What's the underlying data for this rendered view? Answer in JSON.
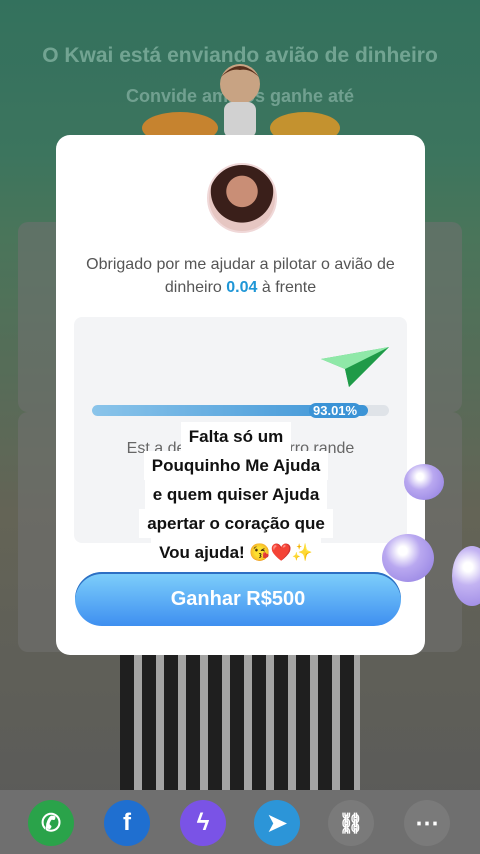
{
  "background": {
    "title": "O Kwai está enviando avião de dinheiro",
    "subtitle": "Convide amigos  ganhe até"
  },
  "modal": {
    "message_prefix": "Obrigado por me ajudar a pilotar o avião de dinheiro",
    "message_amount": "0.04",
    "message_suffix": "à frente",
    "progress_percent_label": "93.01%",
    "progress_value": 0.9301,
    "description": "Est  a de cheg  dirigir carro  rande",
    "cta_label": "Ganhar R$500"
  },
  "caption": {
    "lines": [
      "Falta só um",
      "Pouquinho Me Ajuda",
      "e quem quiser Ajuda",
      "apertar o coração que",
      "Vou ajuda! 😘❤️✨"
    ]
  },
  "share": {
    "items": [
      {
        "icon": "whatsapp-icon",
        "color": "#2aa34a"
      },
      {
        "icon": "facebook-icon",
        "color": "#1f6fd0"
      },
      {
        "icon": "messenger-icon",
        "color": "#7a53e6"
      },
      {
        "icon": "telegram-icon",
        "color": "#2c95d8"
      },
      {
        "icon": "link-icon",
        "color": "#7a7a7a"
      },
      {
        "icon": "more-icon",
        "color": "#7a7a7a"
      }
    ]
  },
  "colors": {
    "accent": "#3b93d6",
    "highlight": "#1f96d6"
  }
}
